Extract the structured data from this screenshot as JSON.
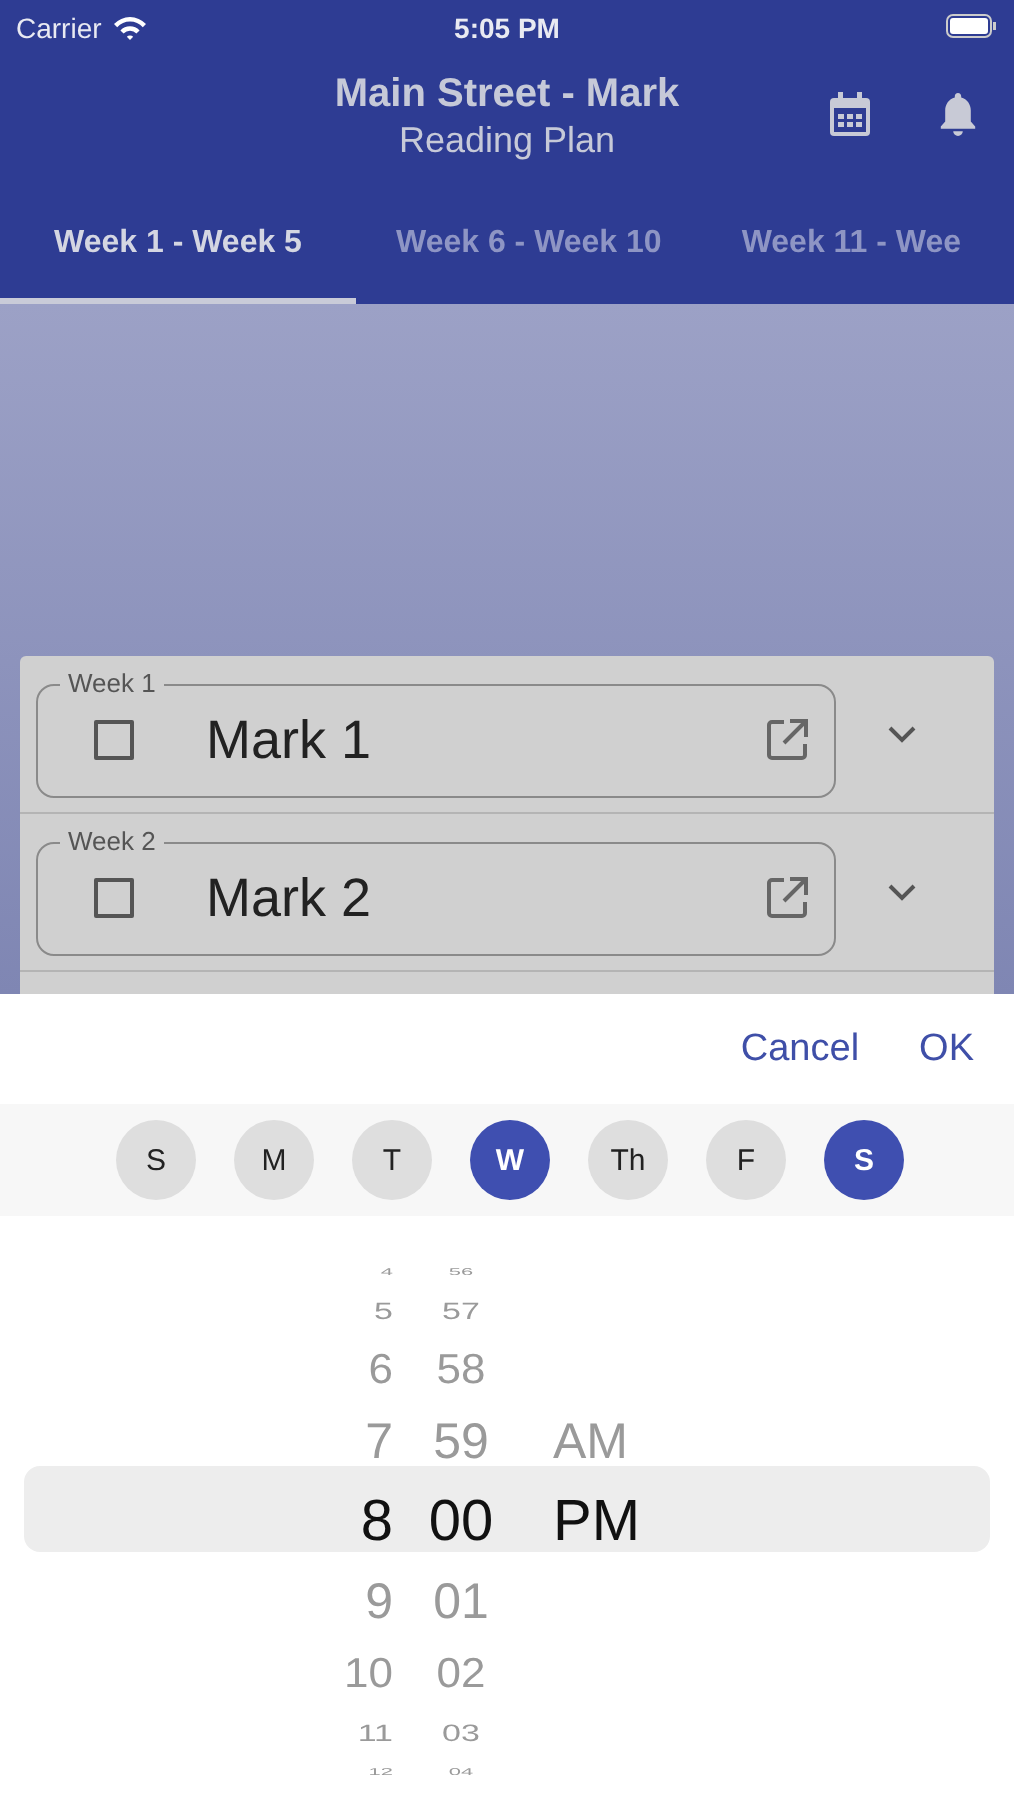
{
  "status_bar": {
    "carrier": "Carrier",
    "time": "5:05 PM"
  },
  "header": {
    "title": "Main Street - Mark",
    "subtitle": "Reading Plan"
  },
  "tabs": [
    {
      "label": "Week 1 - Week 5",
      "selected": true
    },
    {
      "label": "Week 6 - Week 10",
      "selected": false
    },
    {
      "label": "Week 11 - Wee",
      "selected": false
    }
  ],
  "readings": [
    {
      "week": "Week 1",
      "title": "Mark 1",
      "checked": false
    },
    {
      "week": "Week 2",
      "title": "Mark 2",
      "checked": false
    }
  ],
  "sheet": {
    "cancel": "Cancel",
    "ok": "OK",
    "days": [
      {
        "label": "S",
        "selected": false
      },
      {
        "label": "M",
        "selected": false
      },
      {
        "label": "T",
        "selected": false
      },
      {
        "label": "W",
        "selected": true
      },
      {
        "label": "Th",
        "selected": false
      },
      {
        "label": "F",
        "selected": false
      },
      {
        "label": "S",
        "selected": true
      }
    ],
    "wheels": [
      {
        "items": [
          {
            "text": "4",
            "selected": false
          },
          {
            "text": "5",
            "selected": false
          },
          {
            "text": "6",
            "selected": false
          },
          {
            "text": "7",
            "selected": false
          },
          {
            "text": "8",
            "selected": true
          },
          {
            "text": "9",
            "selected": false
          },
          {
            "text": "10",
            "selected": false
          },
          {
            "text": "11",
            "selected": false
          },
          {
            "text": "12",
            "selected": false
          }
        ]
      },
      {
        "items": [
          {
            "text": "56",
            "selected": false
          },
          {
            "text": "57",
            "selected": false
          },
          {
            "text": "58",
            "selected": false
          },
          {
            "text": "59",
            "selected": false
          },
          {
            "text": "00",
            "selected": true
          },
          {
            "text": "01",
            "selected": false
          },
          {
            "text": "02",
            "selected": false
          },
          {
            "text": "03",
            "selected": false
          },
          {
            "text": "04",
            "selected": false
          }
        ]
      },
      {
        "items": [
          {
            "text": "AM",
            "selected": false
          },
          {
            "text": "PM",
            "selected": true
          }
        ]
      }
    ]
  }
}
